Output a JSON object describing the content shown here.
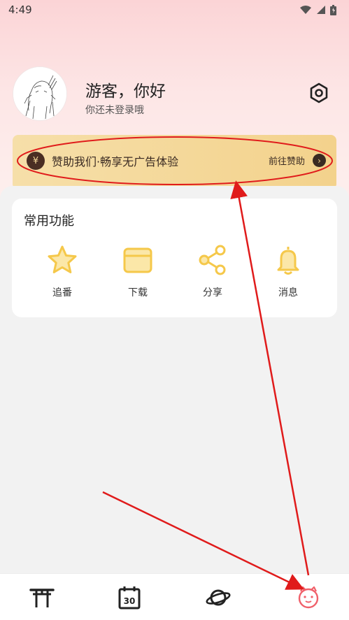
{
  "status_bar": {
    "time": "4:49"
  },
  "profile": {
    "greeting": "游客，你好",
    "login_hint": "你还未登录哦"
  },
  "sponsor": {
    "coin_symbol": "¥",
    "text": "赞助我们·畅享无广告体验",
    "action": "前往赞助",
    "arrow": "›"
  },
  "functions": {
    "title": "常用功能",
    "items": [
      {
        "label": "追番",
        "icon": "star-icon"
      },
      {
        "label": "下载",
        "icon": "folder-icon"
      },
      {
        "label": "分享",
        "icon": "share-icon"
      },
      {
        "label": "消息",
        "icon": "bell-icon"
      }
    ]
  },
  "bottom_nav": {
    "items": [
      {
        "icon": "torii-gate-icon"
      },
      {
        "icon": "calendar-icon"
      },
      {
        "icon": "planet-icon"
      },
      {
        "icon": "pig-face-icon",
        "active": true
      }
    ],
    "active_color": "#f0606a"
  },
  "colors": {
    "accent_yellow": "#f5c84a",
    "annotation_red": "#e01b1b"
  }
}
